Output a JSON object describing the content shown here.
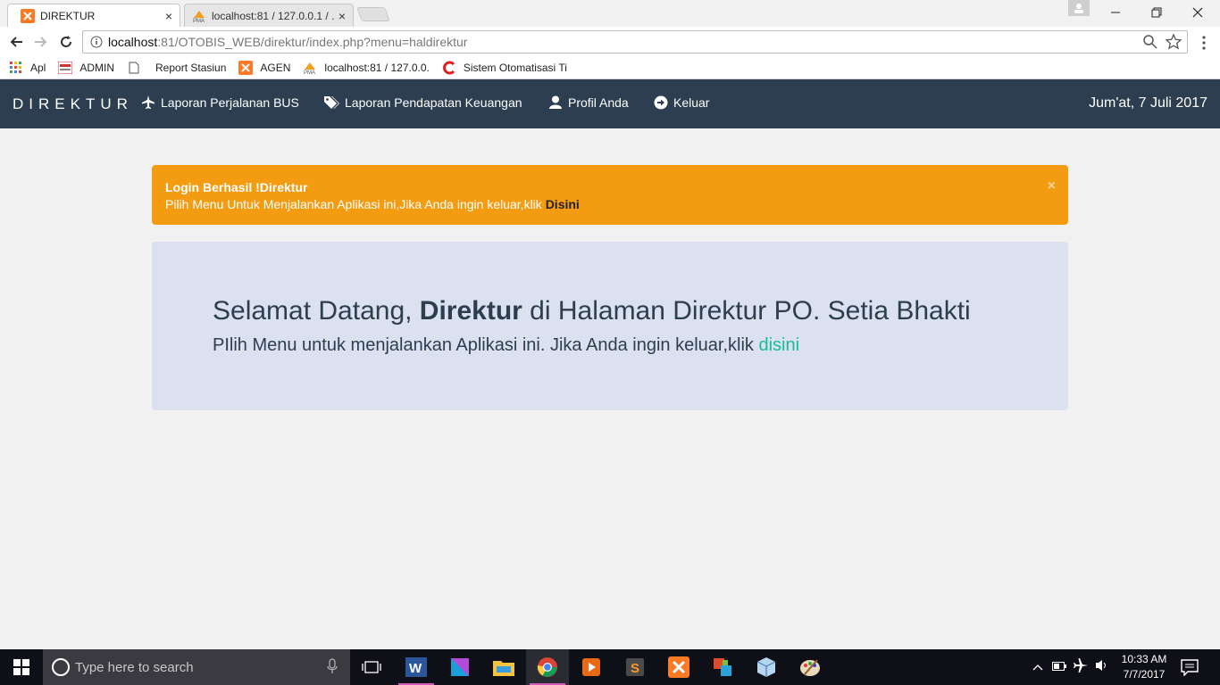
{
  "browser": {
    "tabs": [
      {
        "title": "DIREKTUR",
        "close": "×"
      },
      {
        "title": "localhost:81 / 127.0.0.1 / ...",
        "close": "×"
      }
    ],
    "address": {
      "host": "localhost",
      "path": ":81/OTOBIS_WEB/direktur/index.php?menu=haldirektur"
    },
    "bookmarks": [
      {
        "label": "Apl"
      },
      {
        "label": "ADMIN"
      },
      {
        "label": "Report Stasiun"
      },
      {
        "label": "AGEN"
      },
      {
        "label": "localhost:81 / 127.0.0."
      },
      {
        "label": "Sistem Otomatisasi Ti"
      }
    ]
  },
  "navbar": {
    "brand": "DIREKTUR",
    "items": [
      {
        "label": "Laporan Perjalanan BUS",
        "icon": "plane-icon"
      },
      {
        "label": "Laporan Pendapatan Keuangan",
        "icon": "tags-icon"
      },
      {
        "label": "Profil Anda",
        "icon": "user-icon"
      },
      {
        "label": "Keluar",
        "icon": "arrow-right-circle-icon"
      }
    ],
    "date": "Jum'at, 7 Juli 2017",
    "bg_color": "#2c3e50"
  },
  "alert": {
    "title": "Login Berhasil !Direktur",
    "message": "Pilih Menu Untuk Menjalankan Aplikasi ini,Jika Anda ingin keluar,klik ",
    "link": "Disini",
    "close": "×",
    "color": "#f39c12"
  },
  "jumbotron": {
    "title_prefix": "Selamat Datang, ",
    "title_bold": "Direktur",
    "title_suffix": " di Halaman Direktur PO. Setia Bhakti",
    "text": "PIlih Menu untuk menjalankan Aplikasi ini. Jika Anda ingin keluar,klik ",
    "link": "disini",
    "link_color": "#18bc9c"
  },
  "taskbar": {
    "search_placeholder": "Type here to search",
    "time": "10:33 AM",
    "date": "7/7/2017"
  }
}
